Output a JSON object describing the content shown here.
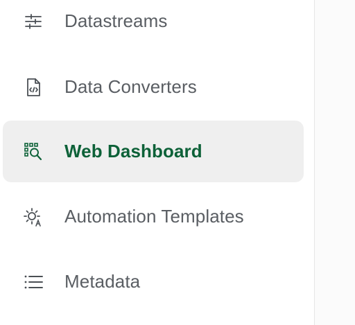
{
  "sidebar": {
    "items": [
      {
        "label": "Datastreams",
        "icon": "datastreams-icon",
        "active": false
      },
      {
        "label": "Data Converters",
        "icon": "code-file-icon",
        "active": false
      },
      {
        "label": "Web Dashboard",
        "icon": "dashboard-search-icon",
        "active": true
      },
      {
        "label": "Automation Templates",
        "icon": "automation-sun-icon",
        "active": false
      },
      {
        "label": "Metadata",
        "icon": "list-icon",
        "active": false
      }
    ]
  },
  "colors": {
    "active_text": "#0d6138",
    "active_background": "#efefef",
    "default_text": "#5a5e63",
    "icon_default": "#4a4f54"
  }
}
